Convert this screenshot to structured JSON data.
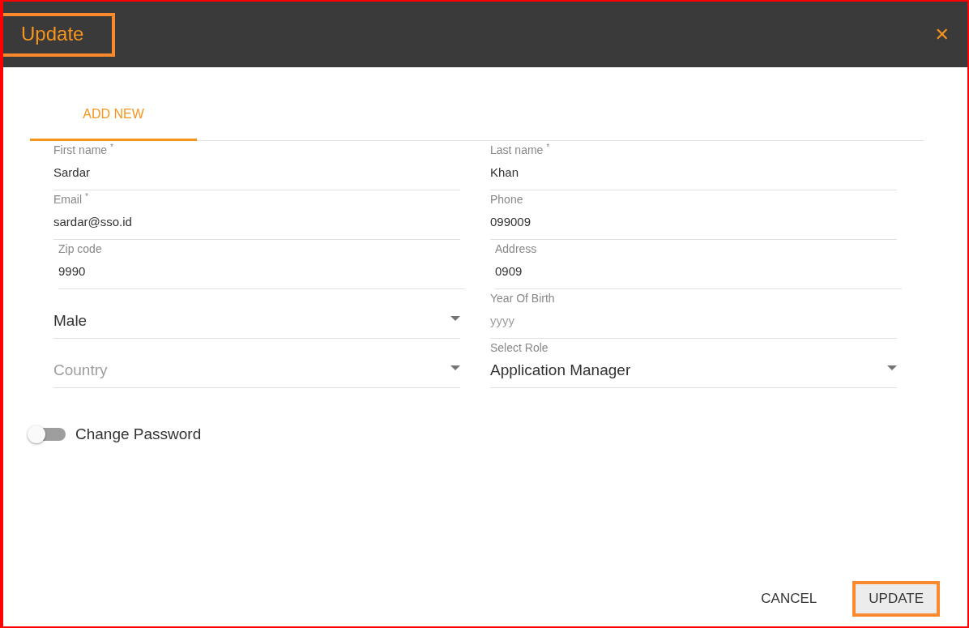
{
  "dialog": {
    "title": "Update",
    "title_highlighted": true,
    "close_icon": "✕"
  },
  "tabs": [
    {
      "label": "ADD NEW",
      "selected": true
    }
  ],
  "fields": [
    {
      "kind": "text",
      "label": "First name $^{*}$",
      "value": "Sardar"
    },
    {
      "kind": "text",
      "label": "Email $^{*}$",
      "value": "sardar@sso.id"
    },
    {
      "kind": "text",
      "label": "Zip code",
      "value": "9990"
    },
    {
      "kind": "select",
      "value": "Male"
    },
    {
      "kind": "select",
      "placeholder": "Country"
    },
    {
      "kind": "text",
      "label": "Last name $^{*}$",
      "value": "Khan"
    },
    {
      "kind": "text",
      "label": "Phone",
      "value": "099009"
    },
    {
      "kind": "text",
      "label": "Address",
      "value": "0909"
    },
    {
      "kind": "text",
      "label": "Year Of Birth",
      "placeholder": "yyyy"
    },
    {
      "kind": "select",
      "label": "Select Role",
      "value": "Application Manager"
    }
  ],
  "toggle": {
    "label": "Change Password",
    "on": false
  },
  "buttons": [
    {
      "label": "CANCEL",
      "kind": "flat",
      "highlighted": false
    },
    {
      "label": "UPDATE",
      "kind": "raised",
      "highlighted": true
    }
  ]
}
